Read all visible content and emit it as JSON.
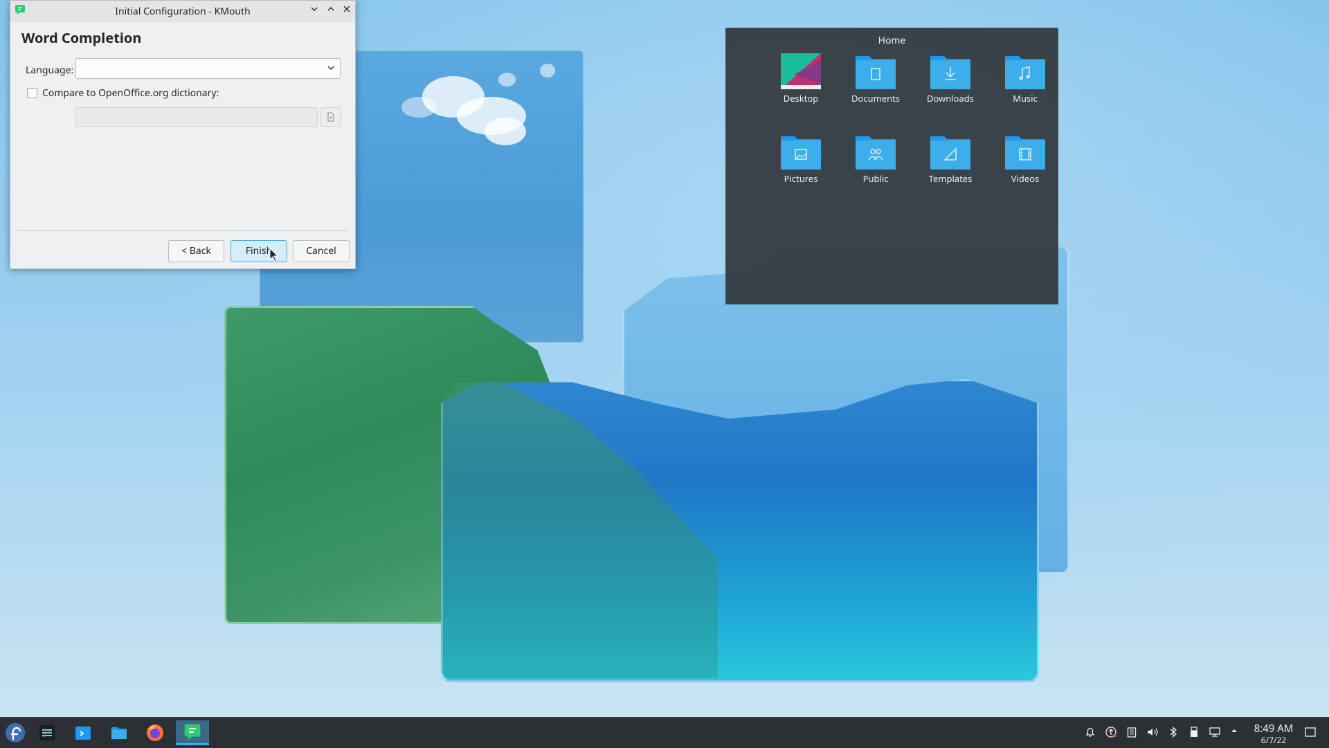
{
  "dialog": {
    "window_title": "Initial Configuration - KMouth",
    "heading": "Word Completion",
    "language_label": "Language:",
    "language_value": "",
    "compare_label": "Compare to OpenOffice.org dictionary:",
    "compare_checked": false,
    "dictionary_path": "",
    "back_label": "< Back",
    "finish_label": "Finish",
    "cancel_label": "Cancel"
  },
  "folder_view": {
    "title": "Home",
    "items": [
      {
        "label": "Desktop",
        "icon": "desktop-folder-icon"
      },
      {
        "label": "Documents",
        "icon": "documents-folder-icon"
      },
      {
        "label": "Downloads",
        "icon": "downloads-folder-icon"
      },
      {
        "label": "Music",
        "icon": "music-folder-icon"
      },
      {
        "label": "Pictures",
        "icon": "pictures-folder-icon"
      },
      {
        "label": "Public",
        "icon": "public-folder-icon"
      },
      {
        "label": "Templates",
        "icon": "templates-folder-icon"
      },
      {
        "label": "Videos",
        "icon": "videos-folder-icon"
      }
    ]
  },
  "taskbar": {
    "clock_time": "8:49 AM",
    "clock_date": "6/7/22"
  },
  "colors": {
    "accent": "#3daee9",
    "folder": "#3daee9",
    "panel": "#2b3034",
    "widget_bg": "#31363b"
  }
}
